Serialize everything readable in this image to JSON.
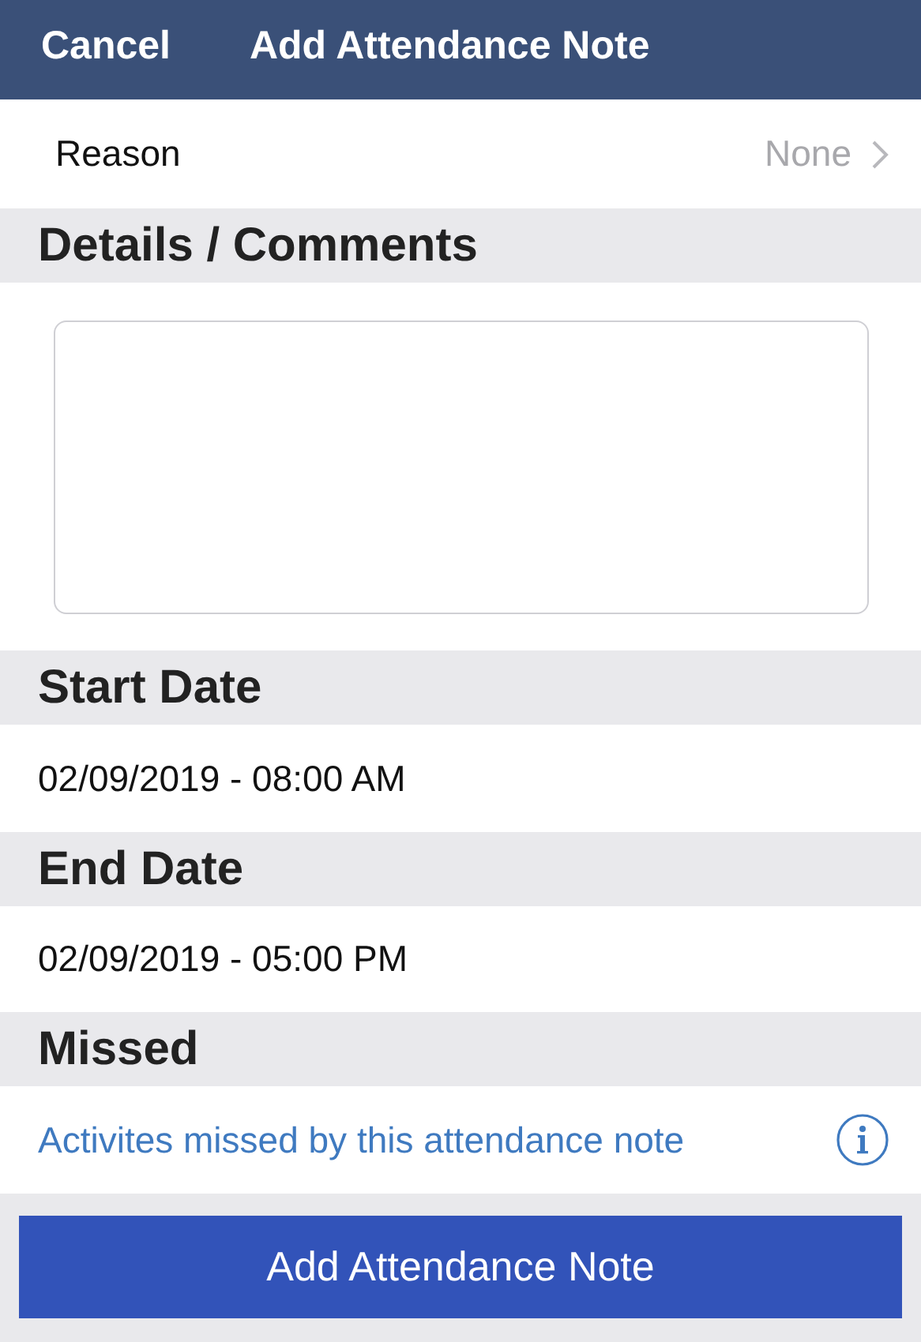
{
  "nav_bar": {
    "cancel": "Cancel",
    "title": "Add Attendance Note"
  },
  "reason": {
    "label": "Reason",
    "value": "None"
  },
  "details": {
    "heading": "Details / Comments"
  },
  "start_date": {
    "heading": "Start Date",
    "value": "02/09/2019 - 08:00 AM"
  },
  "end_date": {
    "heading": "End Date",
    "value": "02/09/2019 - 05:00 PM"
  },
  "missed": {
    "heading": "Missed",
    "link": "Activites missed by this attendance note"
  },
  "submit_button": "Add Attendance Note"
}
